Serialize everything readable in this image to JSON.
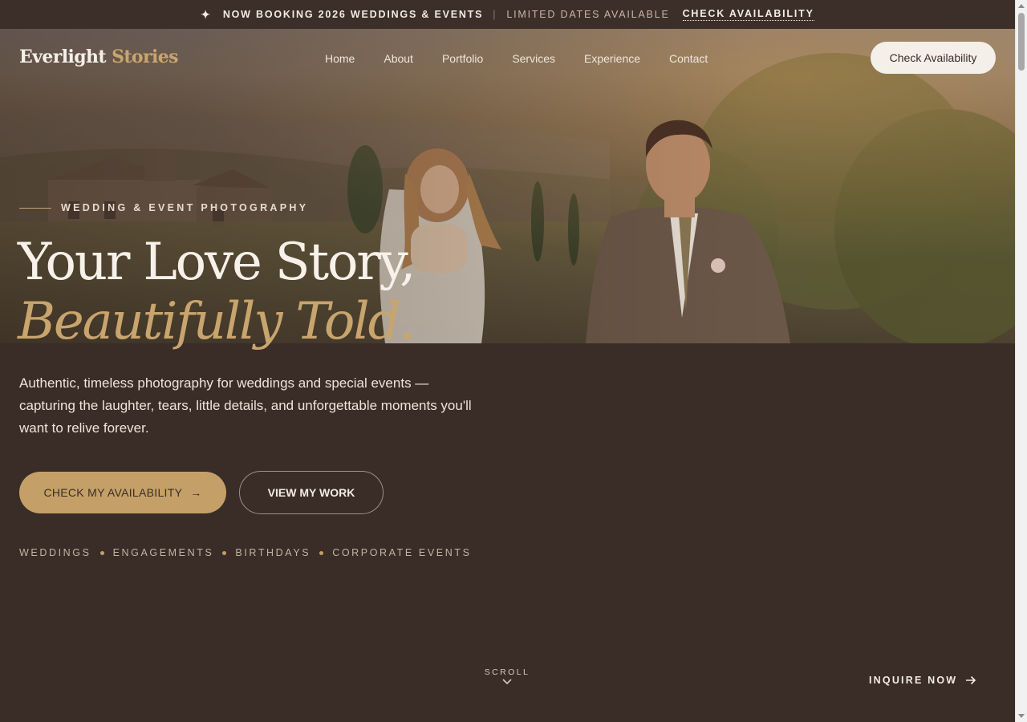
{
  "announcement": {
    "spark_icon": "four-point-star-icon",
    "headline": "NOW BOOKING 2026 WEDDINGS & EVENTS",
    "separator": "|",
    "note": "LIMITED DATES AVAILABLE",
    "link": "CHECK AVAILABILITY"
  },
  "brand": {
    "first": "Everlight",
    "second": "Stories"
  },
  "nav": {
    "items": [
      {
        "label": "Home"
      },
      {
        "label": "About"
      },
      {
        "label": "Portfolio"
      },
      {
        "label": "Services"
      },
      {
        "label": "Experience"
      },
      {
        "label": "Contact"
      }
    ],
    "cta": "Check Availability"
  },
  "hero": {
    "eyebrow": "WEDDING & EVENT PHOTOGRAPHY",
    "headline_line1": "Your Love Story,",
    "headline_line2": "Beautifully Told.",
    "lede": "Authentic, timeless photography for weddings and special events — capturing the laughter, tears, little details, and unforgettable moments you'll want to relive forever.",
    "primary_button": "CHECK MY AVAILABILITY",
    "primary_arrow": "→",
    "secondary_button": "VIEW MY WORK",
    "tags": [
      "WEDDINGS",
      "ENGAGEMENTS",
      "BIRTHDAYS",
      "CORPORATE EVENTS"
    ]
  },
  "footer_hint": {
    "scroll_label": "SCROLL",
    "scroll_icon": "chevron-down-icon",
    "inquire": "INQUIRE NOW",
    "inquire_icon": "arrow-right-icon"
  },
  "colors": {
    "background": "#3a2c26",
    "accent_gold": "#c4a068",
    "cream": "#f4efe8"
  }
}
